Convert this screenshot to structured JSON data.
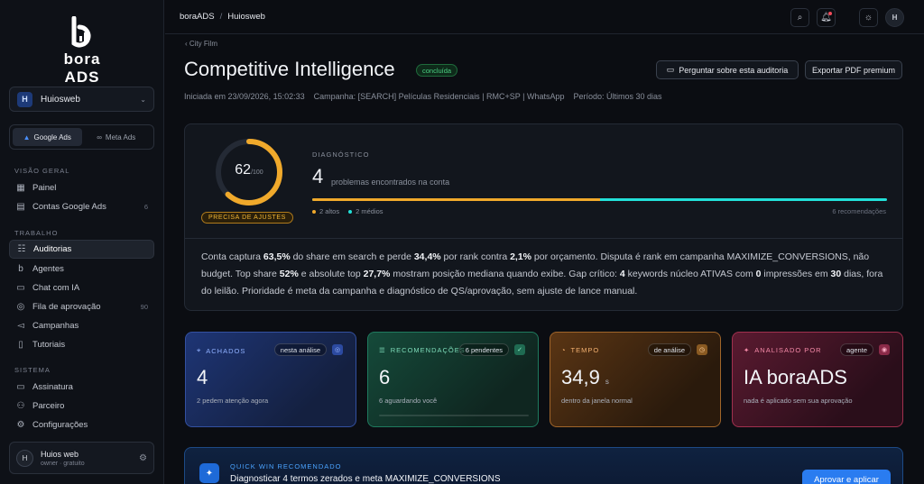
{
  "brand": {
    "logo_text": "bora ADS",
    "mark_letter": "b"
  },
  "workspace": {
    "avatar": "H",
    "name": "Huiosweb"
  },
  "platform_toggle": {
    "google": "Google Ads",
    "meta": "Meta Ads"
  },
  "sidebar": {
    "section_overview": "VISÃO GERAL",
    "section_work": "TRABALHO",
    "section_system": "SISTEMA",
    "items": [
      {
        "label": "Painel",
        "icon": "grid-icon",
        "count": ""
      },
      {
        "label": "Contas Google Ads",
        "icon": "accounts-icon",
        "count": "6"
      },
      {
        "label": "Auditorias",
        "icon": "audit-icon",
        "count": ""
      },
      {
        "label": "Agentes",
        "icon": "agent-icon",
        "count": ""
      },
      {
        "label": "Chat com IA",
        "icon": "chat-icon",
        "count": ""
      },
      {
        "label": "Fila de aprovação",
        "icon": "check-circle-icon",
        "count": "90"
      },
      {
        "label": "Campanhas",
        "icon": "megaphone-icon",
        "count": ""
      },
      {
        "label": "Tutoriais",
        "icon": "book-icon",
        "count": ""
      },
      {
        "label": "Assinatura",
        "icon": "card-icon",
        "count": ""
      },
      {
        "label": "Parceiro",
        "icon": "handshake-icon",
        "count": ""
      },
      {
        "label": "Configurações",
        "icon": "gear-icon",
        "count": ""
      }
    ]
  },
  "user": {
    "avatar": "H",
    "name": "Huios web",
    "role": "owner · gratuito"
  },
  "topbar": {
    "crumb1": "boraADS",
    "crumb_sep": "/",
    "crumb2": "Huiosweb",
    "avatar": "H"
  },
  "page": {
    "back": "‹ City Film",
    "title": "Competitive Intelligence",
    "status": "concluída",
    "ask_button": "Perguntar sobre esta auditoria",
    "pdf_button": "Exportar PDF premium",
    "meta": "Iniciada em 23/09/2026, 15:02:33    Campanha: [SEARCH] Películas Residenciais | RMC+SP | WhatsApp    Período: Últimos 30 dias"
  },
  "diagnostic": {
    "score": "62",
    "score_max": "/100",
    "score_fraction": 0.62,
    "score_badge": "PRECISA DE AJUSTES",
    "label": "DIAGNÓSTICO",
    "problems": "4",
    "problems_text": "problemas encontrados na conta",
    "high_fraction": 0.5,
    "legend_high": "2 altos",
    "legend_medium": "2 médios",
    "recommendations": "6 recomendações",
    "colors": {
      "high": "#f0a92b",
      "medium": "#22e0d8",
      "gauge": "#f0a92b"
    }
  },
  "summary": {
    "p1": "Conta captura ",
    "v1": "63,5%",
    "p2": " do share em search e perde ",
    "v2": "34,4%",
    "p3": " por rank contra ",
    "v3": "2,1%",
    "p4": " por orçamento. Disputa é rank em campanha MAXIMIZE_CONVERSIONS, não budget. Top share ",
    "v4": "52%",
    "p5": " e absolute top ",
    "v5": "27,7%",
    "p6": " mostram posição mediana quando exibe. Gap crítico: ",
    "v6": "4",
    "p7": " keywords núcleo ATIVAS com ",
    "v7": "0",
    "p8": " impressões em ",
    "v8": "30",
    "p9": " dias, fora do leilão. Prioridade é meta da campanha e diagnóstico de QS/aprovação, sem ajuste de lance manual."
  },
  "cards": [
    {
      "label": "ACHADOS",
      "pill": "nesta análise",
      "value": "4",
      "unit": "",
      "sub": "2 pedem atenção agora",
      "color": "#4a7dff",
      "icon": "target-icon"
    },
    {
      "label": "RECOMENDAÇÕES",
      "pill": "6 pendentes",
      "value": "6",
      "unit": "",
      "sub": "6 aguardando você",
      "color": "#3fd0a0",
      "icon": "list-icon"
    },
    {
      "label": "TEMPO",
      "pill": "de análise",
      "value": "34,9",
      "unit": "s",
      "sub": "dentro da janela normal",
      "color": "#f09a3a",
      "icon": "timer-icon"
    },
    {
      "label": "ANALISADO POR",
      "pill": "agente",
      "value": "IA boraADS",
      "unit": "",
      "sub": "nada é aplicado sem sua aprovação",
      "color": "#f05a80",
      "icon": "sparkle-icon"
    }
  ],
  "quick_win": {
    "label": "QUICK WIN RECOMENDADO",
    "title": "Diagnosticar 4 termos zerados e meta MAXIMIZE_CONVERSIONS",
    "button": "Aprovar e aplicar"
  }
}
